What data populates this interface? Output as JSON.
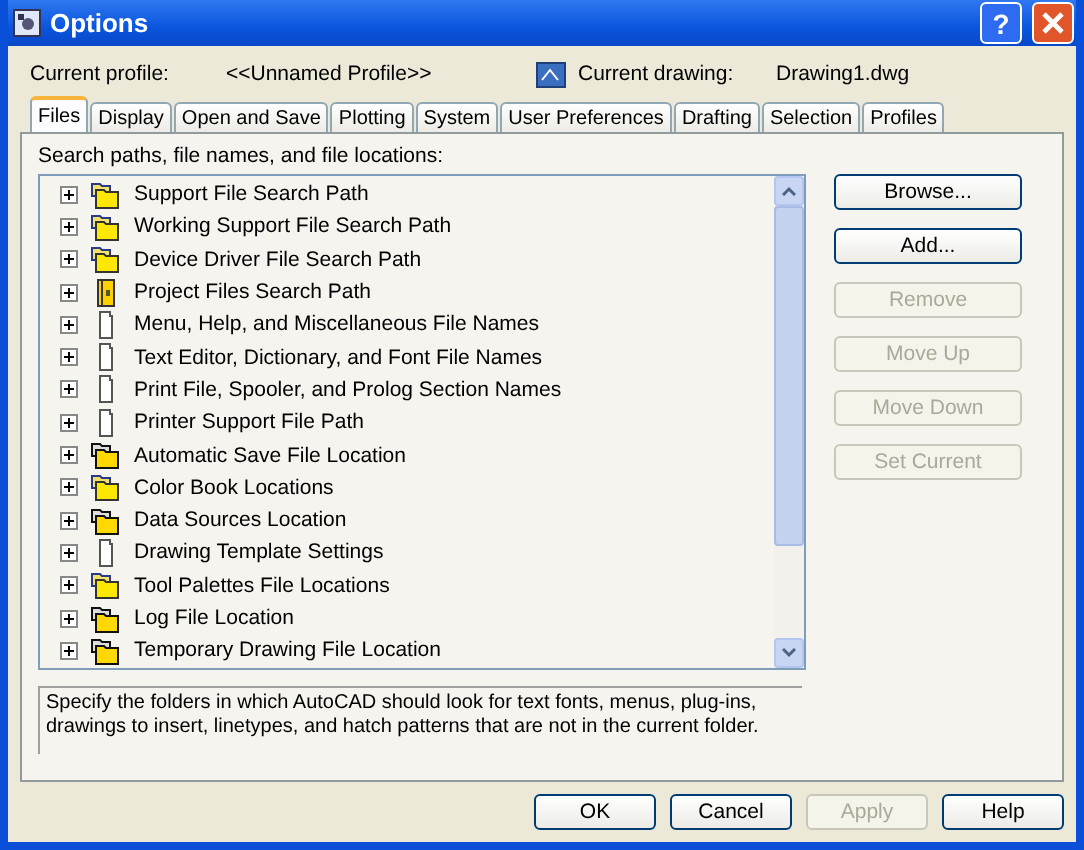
{
  "window": {
    "title": "Options",
    "help_glyph": "?"
  },
  "profile": {
    "label": "Current profile:",
    "value": "<<Unnamed Profile>>"
  },
  "drawing": {
    "label": "Current drawing:",
    "value": "Drawing1.dwg"
  },
  "tabs": [
    {
      "label": "Files",
      "selected": true
    },
    {
      "label": "Display",
      "selected": false
    },
    {
      "label": "Open and Save",
      "selected": false
    },
    {
      "label": "Plotting",
      "selected": false
    },
    {
      "label": "System",
      "selected": false
    },
    {
      "label": "User Preferences",
      "selected": false
    },
    {
      "label": "Drafting",
      "selected": false
    },
    {
      "label": "Selection",
      "selected": false
    },
    {
      "label": "Profiles",
      "selected": false
    }
  ],
  "tree": {
    "label": "Search paths, file names, and file locations:",
    "items": [
      {
        "label": "Support File Search Path",
        "kind": "folders",
        "expanded": false
      },
      {
        "label": "Working Support File Search Path",
        "kind": "folders",
        "expanded": false
      },
      {
        "label": "Device Driver File Search Path",
        "kind": "folders",
        "expanded": false
      },
      {
        "label": "Project Files Search Path",
        "kind": "project",
        "expanded": false
      },
      {
        "label": "Menu, Help, and Miscellaneous File Names",
        "kind": "file",
        "expanded": false
      },
      {
        "label": "Text Editor, Dictionary, and Font File Names",
        "kind": "file",
        "expanded": false
      },
      {
        "label": "Print File, Spooler, and Prolog Section Names",
        "kind": "file",
        "expanded": false
      },
      {
        "label": "Printer Support File Path",
        "kind": "file",
        "expanded": false
      },
      {
        "label": "Automatic Save File Location",
        "kind": "location",
        "expanded": false
      },
      {
        "label": "Color Book Locations",
        "kind": "folders",
        "expanded": false
      },
      {
        "label": "Data Sources Location",
        "kind": "location",
        "expanded": false
      },
      {
        "label": "Drawing Template Settings",
        "kind": "file",
        "expanded": false
      },
      {
        "label": "Tool Palettes File Locations",
        "kind": "folders",
        "expanded": false
      },
      {
        "label": "Log File Location",
        "kind": "location",
        "expanded": false
      },
      {
        "label": "Temporary Drawing File Location",
        "kind": "location",
        "expanded": false
      }
    ]
  },
  "side_buttons": [
    {
      "label": "Browse...",
      "disabled": false
    },
    {
      "label": "Add...",
      "disabled": false
    },
    {
      "label": "Remove",
      "disabled": true
    },
    {
      "label": "Move Up",
      "disabled": true
    },
    {
      "label": "Move Down",
      "disabled": true
    },
    {
      "label": "Set Current",
      "disabled": true
    }
  ],
  "description": "Specify the folders in which AutoCAD should look for text fonts, menus, plug-ins, drawings to insert, linetypes, and hatch patterns that are not in the current folder.",
  "buttons": [
    {
      "label": "OK",
      "disabled": false
    },
    {
      "label": "Cancel",
      "disabled": false
    },
    {
      "label": "Apply",
      "disabled": true
    },
    {
      "label": "Help",
      "disabled": false
    }
  ]
}
